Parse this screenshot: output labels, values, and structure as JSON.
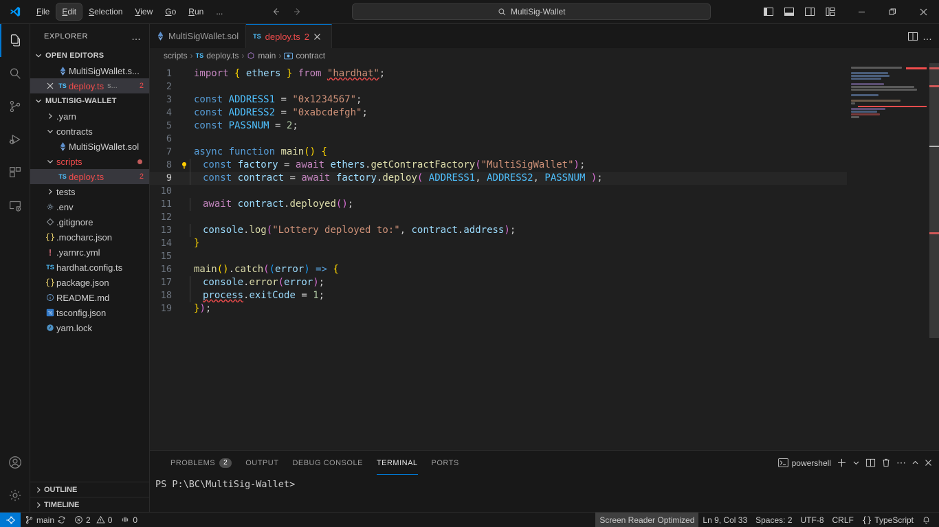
{
  "titlebar": {
    "logo_icon": "vscode-logo-icon",
    "menu": [
      {
        "label": "File",
        "accel": "F"
      },
      {
        "label": "Edit",
        "accel": "E"
      },
      {
        "label": "Selection",
        "accel": "S"
      },
      {
        "label": "View",
        "accel": "V"
      },
      {
        "label": "Go",
        "accel": "G"
      },
      {
        "label": "Run",
        "accel": "R"
      },
      {
        "label": "..."
      }
    ],
    "focused_menu": "Edit",
    "nav": {
      "back_icon": "arrow-left-icon",
      "forward_icon": "arrow-right-icon"
    },
    "quick_input": {
      "icon": "search-icon",
      "value": "MultiSig-Wallet"
    },
    "layout_buttons": [
      {
        "name": "toggle-primary-sidebar"
      },
      {
        "name": "toggle-panel"
      },
      {
        "name": "toggle-secondary-sidebar"
      },
      {
        "name": "customize-layout"
      }
    ],
    "window_controls": {
      "minimize": "—",
      "restore": "restore-icon",
      "close": "✕"
    }
  },
  "activitybar": {
    "items": [
      {
        "name": "explorer",
        "icon": "files-icon",
        "active": true
      },
      {
        "name": "search",
        "icon": "search-icon",
        "active": false
      },
      {
        "name": "source-control",
        "icon": "source-control-icon",
        "active": false
      },
      {
        "name": "run-and-debug",
        "icon": "debug-icon",
        "active": false
      },
      {
        "name": "extensions",
        "icon": "extensions-icon",
        "active": false
      },
      {
        "name": "remote-explorer",
        "icon": "remote-explorer-icon",
        "active": false
      }
    ],
    "bottom": [
      {
        "name": "accounts",
        "icon": "account-icon"
      },
      {
        "name": "manage",
        "icon": "gear-icon"
      }
    ]
  },
  "sidebar": {
    "title": "EXPLORER",
    "more_actions": "…",
    "open_editors": {
      "label": "OPEN EDITORS",
      "items": [
        {
          "name": "MultiSigWallet.s...",
          "icon": "solidity-icon",
          "selected": false,
          "count": ""
        },
        {
          "name": "deploy.ts",
          "icon": "ts-icon",
          "suffix": "s...",
          "selected": true,
          "count": "2",
          "error": true,
          "close": "✕"
        }
      ]
    },
    "project": {
      "label": "MULTISIG-WALLET",
      "items": [
        {
          "name": ".yarn",
          "icon": "folder-chevron",
          "depth": 1,
          "type": "folder",
          "expanded": false
        },
        {
          "name": "contracts",
          "icon": "folder-chevron",
          "depth": 1,
          "type": "folder",
          "expanded": true
        },
        {
          "name": "MultiSigWallet.sol",
          "icon": "solidity-icon",
          "depth": 2,
          "type": "file"
        },
        {
          "name": "scripts",
          "icon": "folder-chevron",
          "depth": 1,
          "type": "folder",
          "expanded": true,
          "error": true,
          "dot": true
        },
        {
          "name": "deploy.ts",
          "icon": "ts-icon",
          "depth": 2,
          "type": "file",
          "selected": true,
          "error": true,
          "count": "2"
        },
        {
          "name": "tests",
          "icon": "folder-chevron",
          "depth": 1,
          "type": "folder",
          "expanded": false
        },
        {
          "name": ".env",
          "icon": "gear-file-icon",
          "depth": 1,
          "type": "file"
        },
        {
          "name": ".gitignore",
          "icon": "git-icon",
          "depth": 1,
          "type": "file"
        },
        {
          "name": ".mocharc.json",
          "icon": "json-icon",
          "depth": 1,
          "type": "file"
        },
        {
          "name": ".yarnrc.yml",
          "icon": "yaml-icon",
          "depth": 1,
          "type": "file"
        },
        {
          "name": "hardhat.config.ts",
          "icon": "ts-icon",
          "depth": 1,
          "type": "file"
        },
        {
          "name": "package.json",
          "icon": "json-icon",
          "depth": 1,
          "type": "file"
        },
        {
          "name": "README.md",
          "icon": "info-icon",
          "depth": 1,
          "type": "file"
        },
        {
          "name": "tsconfig.json",
          "icon": "tsconfig-icon",
          "depth": 1,
          "type": "file"
        },
        {
          "name": "yarn.lock",
          "icon": "yarn-icon",
          "depth": 1,
          "type": "file"
        }
      ]
    },
    "collapsed_sections": [
      {
        "label": "OUTLINE"
      },
      {
        "label": "TIMELINE"
      }
    ]
  },
  "editor": {
    "tabs": [
      {
        "label": "MultiSigWallet.sol",
        "icon": "solidity-icon",
        "active": false
      },
      {
        "label": "deploy.ts",
        "icon": "ts-icon",
        "active": true,
        "count": "2",
        "close": "✕",
        "error": true
      }
    ],
    "tab_actions": [
      {
        "name": "split-editor-right",
        "icon": "split-editor-icon"
      },
      {
        "name": "more-editor-actions",
        "icon": "ellipsis-icon",
        "glyph": "…"
      }
    ],
    "breadcrumb": [
      {
        "label": "scripts",
        "icon": ""
      },
      {
        "label": "deploy.ts",
        "icon": "ts-icon"
      },
      {
        "label": "main",
        "icon": "symbol-method-icon"
      },
      {
        "label": "contract",
        "icon": "symbol-variable-icon"
      }
    ],
    "breadcrumb_separator": "›",
    "current_line": 9,
    "lightbulb_line": 8,
    "lines": [
      {
        "n": 1,
        "tokens": [
          {
            "t": "import ",
            "c": "kw2"
          },
          {
            "t": "{",
            "c": "bry"
          },
          {
            "t": " ethers ",
            "c": "var"
          },
          {
            "t": "}",
            "c": "bry"
          },
          {
            "t": " from ",
            "c": "kw2"
          },
          {
            "t": "\"hardhat\"",
            "c": "str squig"
          },
          {
            "t": ";",
            "c": "pun"
          }
        ]
      },
      {
        "n": 2,
        "tokens": []
      },
      {
        "n": 3,
        "tokens": [
          {
            "t": "const ",
            "c": "kw"
          },
          {
            "t": "ADDRESS1",
            "c": "cst"
          },
          {
            "t": " = ",
            "c": "pun"
          },
          {
            "t": "\"0x1234567\"",
            "c": "str"
          },
          {
            "t": ";",
            "c": "pun"
          }
        ]
      },
      {
        "n": 4,
        "tokens": [
          {
            "t": "const ",
            "c": "kw"
          },
          {
            "t": "ADDRESS2",
            "c": "cst"
          },
          {
            "t": " = ",
            "c": "pun"
          },
          {
            "t": "\"0xabcdefgh\"",
            "c": "str"
          },
          {
            "t": ";",
            "c": "pun"
          }
        ]
      },
      {
        "n": 5,
        "tokens": [
          {
            "t": "const ",
            "c": "kw"
          },
          {
            "t": "PASSNUM",
            "c": "cst"
          },
          {
            "t": " = ",
            "c": "pun"
          },
          {
            "t": "2",
            "c": "num"
          },
          {
            "t": ";",
            "c": "pun"
          }
        ]
      },
      {
        "n": 6,
        "tokens": []
      },
      {
        "n": 7,
        "tokens": [
          {
            "t": "async ",
            "c": "kw"
          },
          {
            "t": "function ",
            "c": "kw"
          },
          {
            "t": "main",
            "c": "fn"
          },
          {
            "t": "()",
            "c": "bry"
          },
          {
            "t": " ",
            "c": "pun"
          },
          {
            "t": "{",
            "c": "bry"
          }
        ]
      },
      {
        "n": 8,
        "indent": 1,
        "tokens": [
          {
            "t": "const ",
            "c": "kw"
          },
          {
            "t": "factory",
            "c": "var"
          },
          {
            "t": " = ",
            "c": "pun"
          },
          {
            "t": "await ",
            "c": "kw2"
          },
          {
            "t": "ethers",
            "c": "var"
          },
          {
            "t": ".",
            "c": "pun"
          },
          {
            "t": "getContractFactory",
            "c": "fn"
          },
          {
            "t": "(",
            "c": "brp"
          },
          {
            "t": "\"MultiSigWallet\"",
            "c": "str"
          },
          {
            "t": ")",
            "c": "brp"
          },
          {
            "t": ";",
            "c": "pun"
          }
        ]
      },
      {
        "n": 9,
        "indent": 1,
        "tokens": [
          {
            "t": "const ",
            "c": "kw"
          },
          {
            "t": "contract",
            "c": "var"
          },
          {
            "t": " = ",
            "c": "pun"
          },
          {
            "t": "await ",
            "c": "kw2"
          },
          {
            "t": "factory",
            "c": "var"
          },
          {
            "t": ".",
            "c": "pun"
          },
          {
            "t": "deploy",
            "c": "fn"
          },
          {
            "t": "(",
            "c": "brp"
          },
          {
            "t": " ",
            "c": "pun"
          },
          {
            "t": "ADDRESS1",
            "c": "cst"
          },
          {
            "t": ", ",
            "c": "pun"
          },
          {
            "t": "ADDRESS2",
            "c": "cst"
          },
          {
            "t": ", ",
            "c": "pun"
          },
          {
            "t": "PASSNUM",
            "c": "cst"
          },
          {
            "t": " ",
            "c": "pun"
          },
          {
            "t": ")",
            "c": "brp"
          },
          {
            "t": ";",
            "c": "pun"
          }
        ]
      },
      {
        "n": 10,
        "indent": 1,
        "tokens": []
      },
      {
        "n": 11,
        "indent": 1,
        "tokens": [
          {
            "t": "await ",
            "c": "kw2"
          },
          {
            "t": "contract",
            "c": "var"
          },
          {
            "t": ".",
            "c": "pun"
          },
          {
            "t": "deployed",
            "c": "fn"
          },
          {
            "t": "()",
            "c": "brp"
          },
          {
            "t": ";",
            "c": "pun"
          }
        ]
      },
      {
        "n": 12,
        "indent": 1,
        "tokens": []
      },
      {
        "n": 13,
        "indent": 1,
        "tokens": [
          {
            "t": "console",
            "c": "var"
          },
          {
            "t": ".",
            "c": "pun"
          },
          {
            "t": "log",
            "c": "fn"
          },
          {
            "t": "(",
            "c": "brp"
          },
          {
            "t": "\"Lottery deployed to:\"",
            "c": "str"
          },
          {
            "t": ", ",
            "c": "pun"
          },
          {
            "t": "contract",
            "c": "var"
          },
          {
            "t": ".",
            "c": "pun"
          },
          {
            "t": "address",
            "c": "var"
          },
          {
            "t": ")",
            "c": "brp"
          },
          {
            "t": ";",
            "c": "pun"
          }
        ]
      },
      {
        "n": 14,
        "tokens": [
          {
            "t": "}",
            "c": "bry"
          }
        ]
      },
      {
        "n": 15,
        "tokens": []
      },
      {
        "n": 16,
        "tokens": [
          {
            "t": "main",
            "c": "fn"
          },
          {
            "t": "()",
            "c": "bry"
          },
          {
            "t": ".",
            "c": "pun"
          },
          {
            "t": "catch",
            "c": "fn"
          },
          {
            "t": "(",
            "c": "brp"
          },
          {
            "t": "(",
            "c": "brb"
          },
          {
            "t": "error",
            "c": "var"
          },
          {
            "t": ")",
            "c": "brb"
          },
          {
            "t": " ",
            "c": "pun"
          },
          {
            "t": "=>",
            "c": "kw"
          },
          {
            "t": " ",
            "c": "pun"
          },
          {
            "t": "{",
            "c": "bry"
          }
        ]
      },
      {
        "n": 17,
        "indent": 1,
        "tokens": [
          {
            "t": "console",
            "c": "var"
          },
          {
            "t": ".",
            "c": "pun"
          },
          {
            "t": "error",
            "c": "fn"
          },
          {
            "t": "(",
            "c": "brp"
          },
          {
            "t": "error",
            "c": "var"
          },
          {
            "t": ")",
            "c": "brp"
          },
          {
            "t": ";",
            "c": "pun"
          }
        ]
      },
      {
        "n": 18,
        "indent": 1,
        "tokens": [
          {
            "t": "process",
            "c": "var squig"
          },
          {
            "t": ".",
            "c": "pun"
          },
          {
            "t": "exitCode",
            "c": "var"
          },
          {
            "t": " = ",
            "c": "pun"
          },
          {
            "t": "1",
            "c": "num"
          },
          {
            "t": ";",
            "c": "pun"
          }
        ]
      },
      {
        "n": 19,
        "tokens": [
          {
            "t": "}",
            "c": "bry"
          },
          {
            "t": ")",
            "c": "brp"
          },
          {
            "t": ";",
            "c": "pun"
          }
        ]
      }
    ]
  },
  "panel": {
    "tabs": [
      {
        "label": "PROBLEMS",
        "badge": "2",
        "active": false
      },
      {
        "label": "OUTPUT",
        "active": false
      },
      {
        "label": "DEBUG CONSOLE",
        "active": false
      },
      {
        "label": "TERMINAL",
        "active": true
      },
      {
        "label": "PORTS",
        "active": false
      }
    ],
    "actions": [
      {
        "name": "terminal-shell-label",
        "label": "powershell",
        "icon": "terminal-icon"
      },
      {
        "name": "new-terminal",
        "glyph": "＋"
      },
      {
        "name": "terminal-dropdown",
        "glyph": "∨"
      },
      {
        "name": "split-terminal",
        "icon": "split-icon"
      },
      {
        "name": "kill-terminal",
        "icon": "trash-icon"
      },
      {
        "name": "panel-more-actions",
        "glyph": "…"
      },
      {
        "name": "maximize-panel",
        "glyph": "∧"
      },
      {
        "name": "close-panel",
        "glyph": "✕"
      }
    ],
    "terminal_prompt": "PS P:\\BC\\MultiSig-Wallet>"
  },
  "statusbar": {
    "remote_icon": "remote-window-icon",
    "left": [
      {
        "name": "branch",
        "icon": "git-branch-icon",
        "label": "main",
        "sync_icon": "sync-icon"
      },
      {
        "name": "problems",
        "errors": "2",
        "warnings": "0",
        "error_icon": "error-icon",
        "warning_icon": "warning-icon"
      },
      {
        "name": "ports",
        "icon": "ports-icon",
        "label": "0"
      }
    ],
    "right": [
      {
        "name": "screen-reader-mode",
        "label": "Screen Reader Optimized",
        "highlighted": true
      },
      {
        "name": "editor-position",
        "label": "Ln 9, Col 33"
      },
      {
        "name": "indentation",
        "label": "Spaces: 2"
      },
      {
        "name": "encoding",
        "label": "UTF-8"
      },
      {
        "name": "eol",
        "label": "CRLF"
      },
      {
        "name": "language-mode",
        "label": "TypeScript",
        "icon": "json-brace-icon"
      },
      {
        "name": "notifications",
        "icon": "bell-icon"
      }
    ]
  },
  "colors": {
    "accent": "#0078d4",
    "error": "#f14c4c",
    "bg": "#1f1f1f",
    "chrome": "#181818",
    "selection": "#37373d"
  }
}
